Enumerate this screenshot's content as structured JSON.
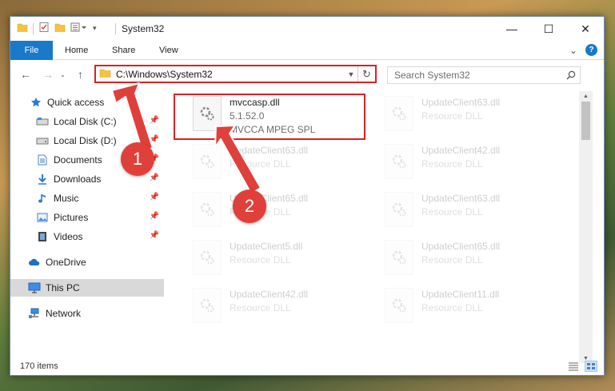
{
  "window": {
    "title": "System32",
    "caption": {
      "minimize": "—",
      "maximize": "☐",
      "close": "✕"
    }
  },
  "ribbon": {
    "file": "File",
    "tabs": [
      "Home",
      "Share",
      "View"
    ],
    "expand": "⌄",
    "help": "?"
  },
  "address": {
    "path": "C:\\Windows\\System32",
    "search_placeholder": "Search System32"
  },
  "sidebar": {
    "items": [
      {
        "label": "Quick access",
        "icon": "star-icon"
      },
      {
        "label": "Local Disk (C:)",
        "icon": "drive-icon",
        "pinned": true
      },
      {
        "label": "Local Disk (D:)",
        "icon": "drive-icon",
        "pinned": true
      },
      {
        "label": "Documents",
        "icon": "documents-icon",
        "pinned": true
      },
      {
        "label": "Downloads",
        "icon": "downloads-icon",
        "pinned": true
      },
      {
        "label": "Music",
        "icon": "music-icon",
        "pinned": true
      },
      {
        "label": "Pictures",
        "icon": "pictures-icon",
        "pinned": true
      },
      {
        "label": "Videos",
        "icon": "videos-icon",
        "pinned": true
      },
      {
        "label": "OneDrive",
        "icon": "cloud-icon"
      },
      {
        "label": "This PC",
        "icon": "computer-icon",
        "selected": true
      },
      {
        "label": "Network",
        "icon": "network-icon"
      }
    ]
  },
  "files": {
    "highlighted": {
      "name": "mvccasp.dll",
      "version": "5.1.52.0",
      "description": "MVCCA MPEG SPL"
    },
    "col1": [
      {
        "name": "UpdateClient63.dll",
        "type": "Resource DLL"
      },
      {
        "name": "UpdateClient65.dll",
        "type": "Resource DLL"
      },
      {
        "name": "UpdateClient5.dll",
        "type": "Resource DLL"
      },
      {
        "name": "UpdateClient42.dll",
        "type": "Resource DLL"
      }
    ],
    "col2": [
      {
        "name": "UpdateClient63.dll",
        "type": "Resource DLL"
      },
      {
        "name": "UpdateClient42.dll",
        "type": "Resource DLL"
      },
      {
        "name": "UpdateClient63.dll",
        "type": "Resource DLL"
      },
      {
        "name": "UpdateClient65.dll",
        "type": "Resource DLL"
      },
      {
        "name": "UpdateClient11.dll",
        "type": "Resource DLL"
      }
    ]
  },
  "status": {
    "items_count": "170 items"
  },
  "annotations": {
    "step1": "1",
    "step2": "2"
  },
  "colors": {
    "accent": "#1979ca",
    "annotation": "#e01f1f",
    "badge": "#e0403a"
  }
}
